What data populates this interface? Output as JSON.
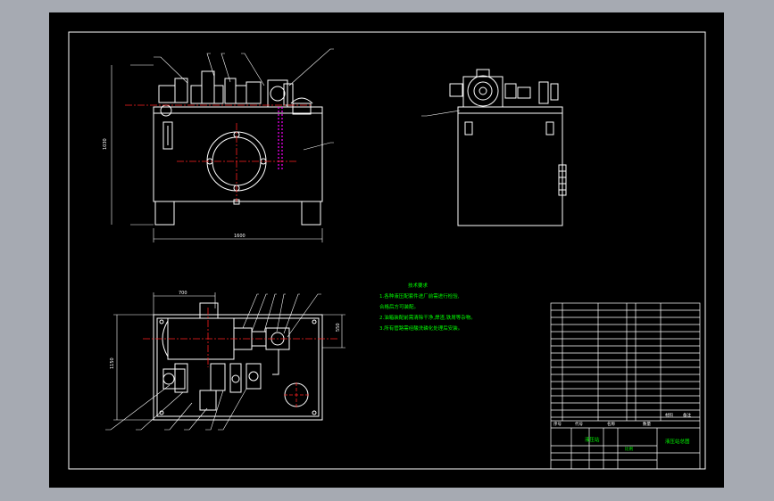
{
  "drawing": {
    "colors": {
      "background": "#000000",
      "outline": "#ffffff",
      "centerline": "#ff2020",
      "notes_text": "#00ff00",
      "hatch": "#ff00ff",
      "frame_bg": "#a6aab2"
    },
    "dimensions": {
      "front_height": "1030",
      "front_width": "1600",
      "plan_width": "700",
      "plan_height": "1150",
      "plan_right": "550"
    },
    "tech_requirements": {
      "title": "技术要求",
      "lines": [
        "1.各种液压配套件进厂前需进行检验,",
        "  合格后方可装配。",
        "2.油箱装配前需清除干净,焊渣,铁屑等杂物。",
        "3.所有管路需经酸洗磷化处理后安装。"
      ]
    },
    "title_block": {
      "header": [
        "序号",
        "代号",
        "名称",
        "数量",
        "材料",
        "备注"
      ],
      "unit_label": "液压站",
      "drawing_name": "液压站总图",
      "scale_label": "比例"
    }
  }
}
